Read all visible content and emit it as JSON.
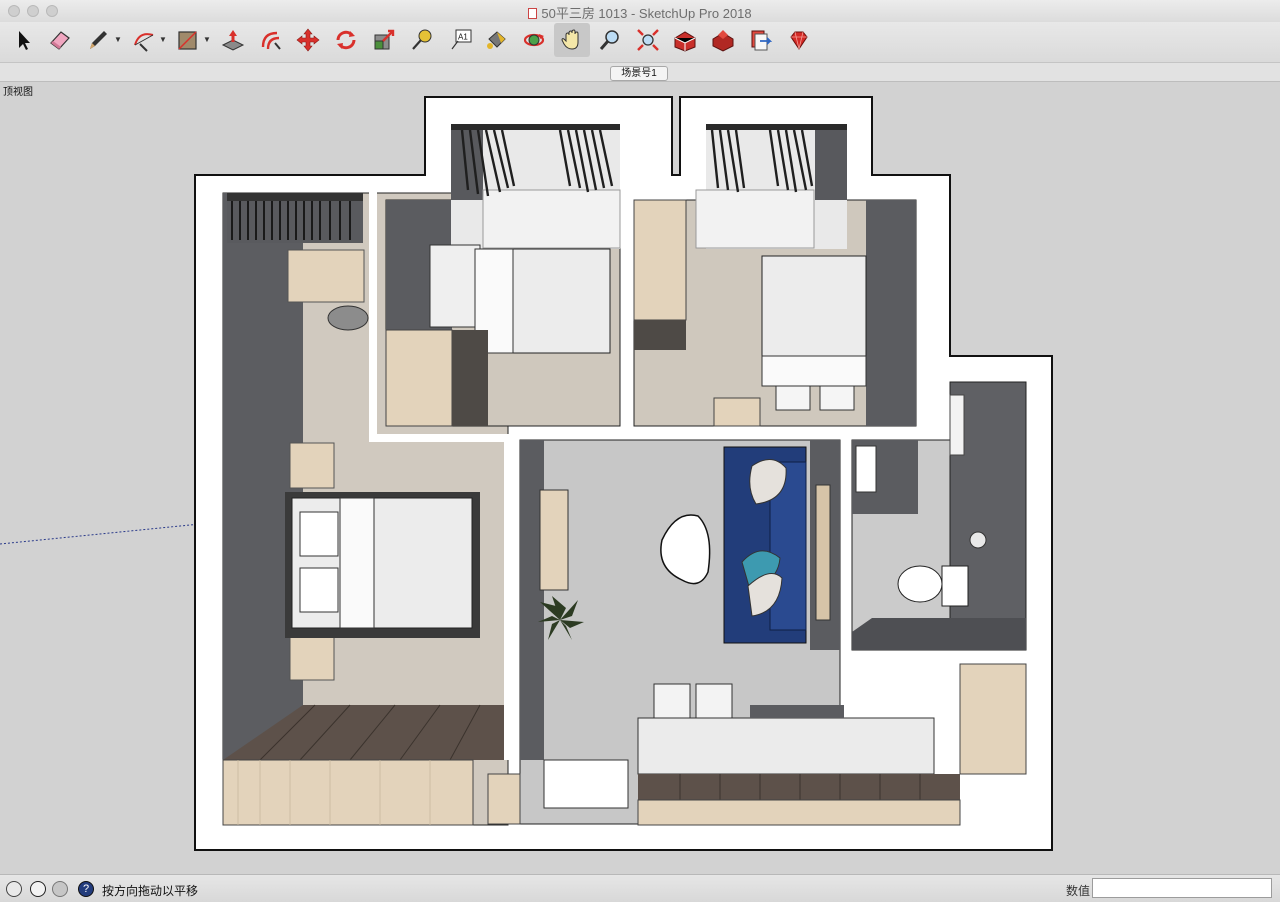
{
  "window": {
    "title": "50平三房 1013 - SketchUp Pro 2018"
  },
  "toolbar": {
    "tools": [
      {
        "name": "select-tool",
        "icon": "arrow-cursor-icon"
      },
      {
        "name": "eraser-tool",
        "icon": "eraser-icon"
      },
      {
        "name": "line-tool",
        "icon": "pencil-icon",
        "dropdown": true
      },
      {
        "name": "arc-tool",
        "icon": "arc-icon",
        "dropdown": true
      },
      {
        "name": "rectangle-tool",
        "icon": "rectangle-icon",
        "dropdown": true
      },
      {
        "name": "push-pull-tool",
        "icon": "push-pull-icon"
      },
      {
        "name": "offset-tool",
        "icon": "offset-icon"
      },
      {
        "name": "move-tool",
        "icon": "move-arrows-icon"
      },
      {
        "name": "rotate-tool",
        "icon": "rotate-icon"
      },
      {
        "name": "scale-tool",
        "icon": "scale-icon"
      },
      {
        "name": "tape-measure-tool",
        "icon": "tape-measure-icon"
      },
      {
        "name": "text-tool",
        "icon": "text-label-icon",
        "text": "A1"
      },
      {
        "name": "paint-bucket-tool",
        "icon": "paint-bucket-icon"
      },
      {
        "name": "orbit-tool",
        "icon": "orbit-icon"
      },
      {
        "name": "pan-tool",
        "icon": "hand-icon",
        "active": true
      },
      {
        "name": "zoom-tool",
        "icon": "magnifier-icon"
      },
      {
        "name": "zoom-extents-tool",
        "icon": "zoom-extents-icon"
      },
      {
        "name": "warehouse-tool",
        "icon": "3d-warehouse-icon"
      },
      {
        "name": "extension-warehouse-tool",
        "icon": "extension-warehouse-icon"
      },
      {
        "name": "send-to-layout-tool",
        "icon": "send-to-layout-icon"
      },
      {
        "name": "ruby-console-tool",
        "icon": "ruby-gem-icon"
      }
    ]
  },
  "scenes": {
    "active": "场景号1"
  },
  "viewport": {
    "label": "顶视图"
  },
  "status": {
    "message": "按方向拖动以平移",
    "measurements_label": "数值",
    "measurements_value": ""
  },
  "colors": {
    "wall_white": "#ffffff",
    "outline": "#111111",
    "floor_wood": "#cfc7bd",
    "dark_wall": "#5a5a5e",
    "light_wood": "#e3d3bb",
    "dark_floor": "#5e524a",
    "marble": "#c9c9c9",
    "sofa_blue": "#223d7a",
    "toolbar_red": "#d9302b"
  }
}
